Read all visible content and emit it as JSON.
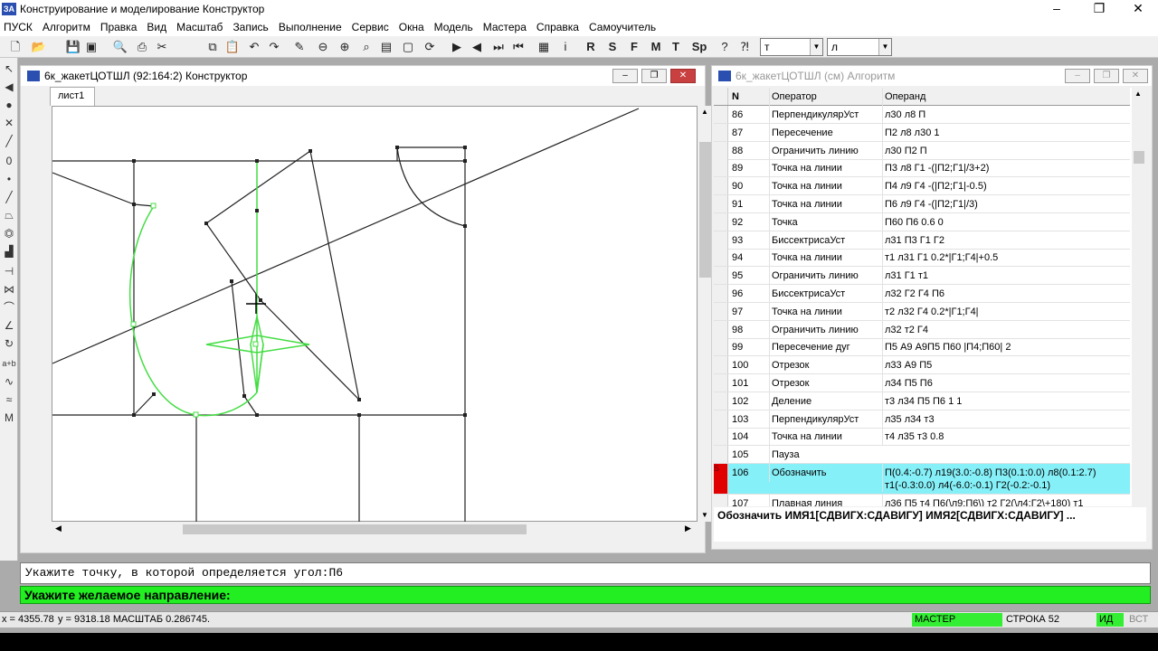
{
  "app": {
    "title": "Конструирование и моделирование  Конструктор",
    "icon_text": "ЗА"
  },
  "window_controls": {
    "minimize": "–",
    "restore": "❐",
    "close": "✕"
  },
  "menu": [
    "ПУСК",
    "Алгоритм",
    "Правка",
    "Вид",
    "Масштаб",
    "Запись",
    "Выполнение",
    "Сервис",
    "Окна",
    "Модель",
    "Мастера",
    "Справка",
    "Самоучитель"
  ],
  "toolbar": {
    "letters": [
      "R",
      "S",
      "F",
      "M",
      "T",
      "Sp"
    ],
    "select1": "т",
    "select2": "л"
  },
  "constructor": {
    "title": "6к_жакетЦОТШЛ (92:164:2) Конструктор",
    "tab": "лист1"
  },
  "algorithm": {
    "title": "6к_жакетЦОТШЛ (см) Алгоритм",
    "headers": {
      "n": "N",
      "operator": "Оператор",
      "operand": "Операнд"
    },
    "rows": [
      {
        "n": "86",
        "op": "ПерпендикулярУст",
        "arg": "л30 л8 П"
      },
      {
        "n": "87",
        "op": "Пересечение",
        "arg": "П2 л8 л30 1"
      },
      {
        "n": "88",
        "op": "Ограничить линию",
        "arg": "л30 П2 П"
      },
      {
        "n": "89",
        "op": "Точка на линии",
        "arg": "П3 л8 Г1 -(|П2;Г1|/3+2)"
      },
      {
        "n": "90",
        "op": "Точка на линии",
        "arg": "П4 л9 Г4 -(|П2;Г1|-0.5)"
      },
      {
        "n": "91",
        "op": "Точка на линии",
        "arg": "П6 л9 Г4 -(|П2;Г1|/3)"
      },
      {
        "n": "92",
        "op": "Точка",
        "arg": "П60 П6 0.6 0"
      },
      {
        "n": "93",
        "op": "БиссектрисаУст",
        "arg": "л31 П3 Г1 Г2"
      },
      {
        "n": "94",
        "op": "Точка на линии",
        "arg": "т1 л31 Г1 0.2*|Г1;Г4|+0.5"
      },
      {
        "n": "95",
        "op": "Ограничить линию",
        "arg": "л31 Г1 т1"
      },
      {
        "n": "96",
        "op": "БиссектрисаУст",
        "arg": "л32 Г2 Г4 П6"
      },
      {
        "n": "97",
        "op": "Точка на линии",
        "arg": "т2 л32 Г4 0.2*|Г1;Г4|"
      },
      {
        "n": "98",
        "op": "Ограничить линию",
        "arg": "л32 т2 Г4"
      },
      {
        "n": "99",
        "op": "Пересечение дуг",
        "arg": "П5 А9 А9П5 П60 |П4;П60| 2"
      },
      {
        "n": "100",
        "op": "Отрезок",
        "arg": "л33 А9 П5"
      },
      {
        "n": "101",
        "op": "Отрезок",
        "arg": "л34 П5 П6"
      },
      {
        "n": "102",
        "op": "Деление",
        "arg": "т3 л34 П5 П6 1 1"
      },
      {
        "n": "103",
        "op": "ПерпендикулярУст",
        "arg": "л35 л34 т3"
      },
      {
        "n": "104",
        "op": "Точка на линии",
        "arg": "т4 л35 т3 0.8"
      },
      {
        "n": "105",
        "op": "Пауза",
        "arg": ""
      }
    ],
    "selected": {
      "marker": "S",
      "n": "106",
      "op": "Обозначить",
      "arg": "П(0.4:-0.7) л19(3.0:-0.8) П3(0.1:0.0) л8(0.1:2.7) т1(-0.3:0.0) л4(-6.0:-0.1) Г2(-0.2:-0.1)"
    },
    "last": {
      "n": "107",
      "op": "Плавная линия",
      "arg": "л36 П5 т4 П6(\\л9;П6\\) т2 Г2(\\л4;Г2\\+180) т1"
    },
    "footer": "Обозначить ИМЯ1[СДВИГХ:СДАВИГУ] ИМЯ2[СДВИГХ:СДАВИГУ] ..."
  },
  "command": {
    "prompt": "Укажите точку, в которой определяется угол:П6",
    "active": "Укажите желаемое направление:"
  },
  "status": {
    "x": "x = 4355.78",
    "y": "y = 9318.18  МАСШТАБ 0.286745.",
    "mode": "МАСТЕР",
    "line": "СТРОКА 52",
    "id": "ИД",
    "ins": "ВСТ"
  }
}
